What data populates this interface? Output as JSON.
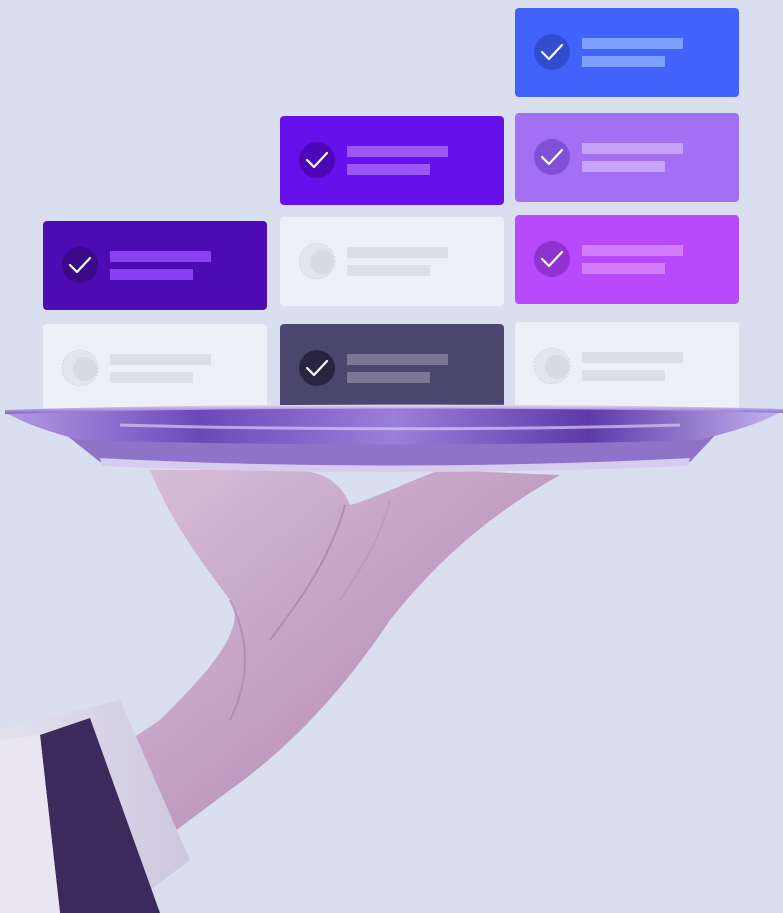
{
  "colors": {
    "background": "#dadff0",
    "blue": "#4263fb",
    "violet": "#6610eb",
    "deep_violet": "#4e0bb3",
    "lavender": "#a370f4",
    "magenta": "#b84afc",
    "slate": "#4b466e",
    "light": "#eef0f8"
  },
  "icons": {
    "done": "check-circle-icon",
    "pending": "stipple-circle-icon"
  },
  "cards": [
    {
      "id": "col3-row1",
      "status": "done",
      "tone": "blue"
    },
    {
      "id": "col2-row1",
      "status": "done",
      "tone": "violet"
    },
    {
      "id": "col3-row2",
      "status": "done",
      "tone": "lavender"
    },
    {
      "id": "col1-row1",
      "status": "done",
      "tone": "deep_violet"
    },
    {
      "id": "col2-row2",
      "status": "pending",
      "tone": "light"
    },
    {
      "id": "col3-row3",
      "status": "done",
      "tone": "magenta"
    },
    {
      "id": "col1-row2",
      "status": "pending",
      "tone": "light"
    },
    {
      "id": "col2-row3",
      "status": "done",
      "tone": "slate"
    },
    {
      "id": "col3-row4",
      "status": "pending",
      "tone": "light"
    }
  ]
}
